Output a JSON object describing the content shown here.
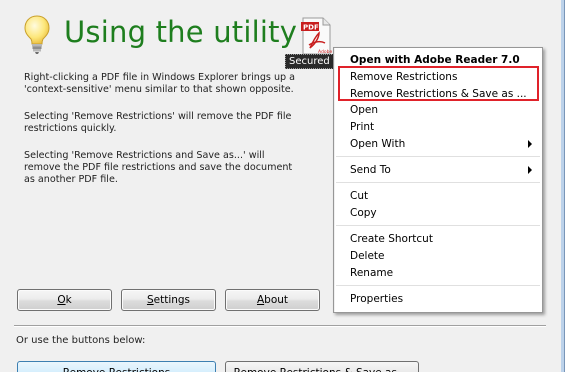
{
  "title": "Using the utility",
  "file_icon": {
    "icon": "pdf-file-icon",
    "brand_text": "PDF",
    "subtext": "Adobe",
    "caption": "Secured"
  },
  "paragraphs": [
    "Right-clicking a PDF file in Windows Explorer brings up a 'context-sensitive' menu similar to that shown opposite.",
    "Selecting 'Remove Restrictions' will remove the PDF file restrictions quickly.",
    "Selecting 'Remove Restrictions and Save as...' will remove the PDF file restrictions and save the document as another PDF file."
  ],
  "buttons": {
    "ok_mnemonic": "O",
    "ok_rest": "k",
    "settings_mnemonic": "S",
    "settings_rest": "ettings",
    "about_mnemonic": "A",
    "about_rest": "bout"
  },
  "hint": "Or use the buttons below:",
  "bottom_buttons": [
    "Remove Restrictions",
    "Remove Restrictions & Save as ..."
  ],
  "context_menu": {
    "open_with_adobe": "Open with Adobe Reader 7.0",
    "remove": "Remove Restrictions",
    "remove_save": "Remove Restrictions & Save as ...",
    "open": "Open",
    "print": "Print",
    "open_with": "Open With",
    "send_to": "Send To",
    "cut": "Cut",
    "copy": "Copy",
    "create_shortcut": "Create Shortcut",
    "delete": "Delete",
    "rename": "Rename",
    "properties": "Properties"
  },
  "colors": {
    "title_green": "#1e7e1e",
    "highlight_red": "#e0222a"
  }
}
